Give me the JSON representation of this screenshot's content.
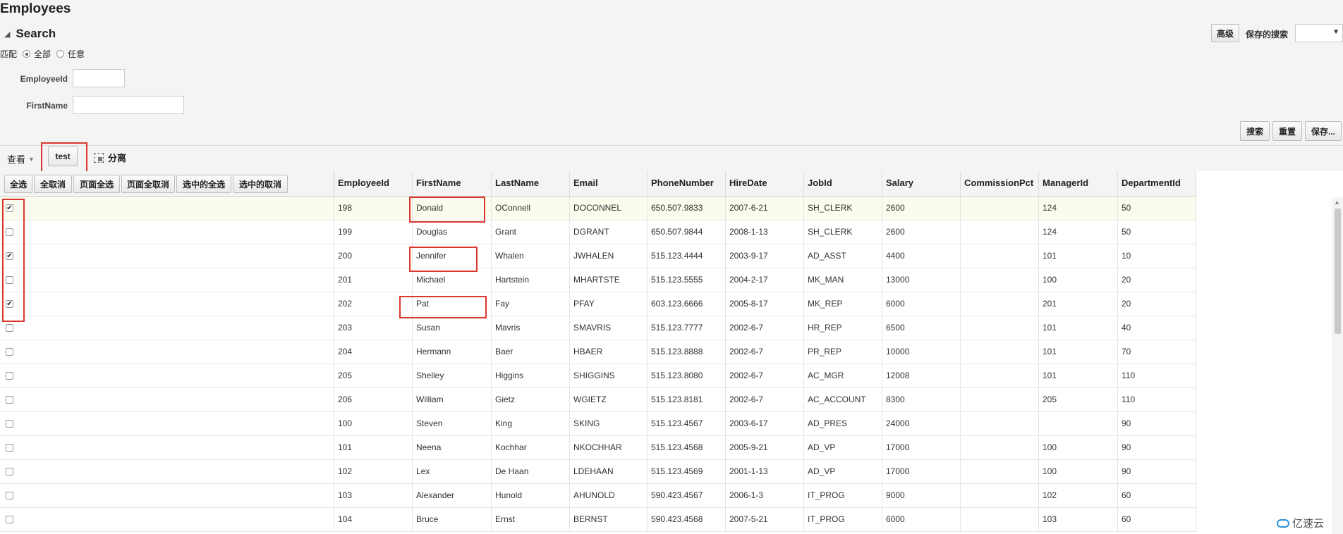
{
  "page_title": "Employees",
  "search": {
    "title": "Search",
    "match_label": "匹配",
    "match_all": "全部",
    "match_any": "任意",
    "fields": [
      {
        "label": "EmployeeId",
        "value": ""
      },
      {
        "label": "FirstName",
        "value": ""
      }
    ],
    "advanced_label": "高级",
    "saved_search_label": "保存的搜索",
    "saved_search_value": "",
    "search_button": "搜索",
    "reset_button": "重置",
    "save_button": "保存..."
  },
  "toolbar": {
    "view_label": "查看",
    "test_button": "test",
    "detach_label": "分离"
  },
  "selection_buttons": [
    "全选",
    "全取消",
    "页面全选",
    "页面全取消",
    "选中的全选",
    "选中的取消"
  ],
  "columns": [
    "EmployeeId",
    "FirstName",
    "LastName",
    "Email",
    "PhoneNumber",
    "HireDate",
    "JobId",
    "Salary",
    "CommissionPct",
    "ManagerId",
    "DepartmentId"
  ],
  "rows": [
    {
      "checked": true,
      "cells": [
        "198",
        "Donald",
        "OConnell",
        "DOCONNEL",
        "650.507.9833",
        "2007-6-21",
        "SH_CLERK",
        "2600",
        "",
        "124",
        "50"
      ]
    },
    {
      "checked": false,
      "cells": [
        "199",
        "Douglas",
        "Grant",
        "DGRANT",
        "650.507.9844",
        "2008-1-13",
        "SH_CLERK",
        "2600",
        "",
        "124",
        "50"
      ]
    },
    {
      "checked": true,
      "cells": [
        "200",
        "Jennifer",
        "Whalen",
        "JWHALEN",
        "515.123.4444",
        "2003-9-17",
        "AD_ASST",
        "4400",
        "",
        "101",
        "10"
      ]
    },
    {
      "checked": false,
      "cells": [
        "201",
        "Michael",
        "Hartstein",
        "MHARTSTE",
        "515.123.5555",
        "2004-2-17",
        "MK_MAN",
        "13000",
        "",
        "100",
        "20"
      ]
    },
    {
      "checked": true,
      "cells": [
        "202",
        "Pat",
        "Fay",
        "PFAY",
        "603.123.6666",
        "2005-8-17",
        "MK_REP",
        "6000",
        "",
        "201",
        "20"
      ]
    },
    {
      "checked": false,
      "cells": [
        "203",
        "Susan",
        "Mavris",
        "SMAVRIS",
        "515.123.7777",
        "2002-6-7",
        "HR_REP",
        "6500",
        "",
        "101",
        "40"
      ]
    },
    {
      "checked": false,
      "cells": [
        "204",
        "Hermann",
        "Baer",
        "HBAER",
        "515.123.8888",
        "2002-6-7",
        "PR_REP",
        "10000",
        "",
        "101",
        "70"
      ]
    },
    {
      "checked": false,
      "cells": [
        "205",
        "Shelley",
        "Higgins",
        "SHIGGINS",
        "515.123.8080",
        "2002-6-7",
        "AC_MGR",
        "12008",
        "",
        "101",
        "110"
      ]
    },
    {
      "checked": false,
      "cells": [
        "206",
        "William",
        "Gietz",
        "WGIETZ",
        "515.123.8181",
        "2002-6-7",
        "AC_ACCOUNT",
        "8300",
        "",
        "205",
        "110"
      ]
    },
    {
      "checked": false,
      "cells": [
        "100",
        "Steven",
        "King",
        "SKING",
        "515.123.4567",
        "2003-6-17",
        "AD_PRES",
        "24000",
        "",
        "",
        "90"
      ]
    },
    {
      "checked": false,
      "cells": [
        "101",
        "Neena",
        "Kochhar",
        "NKOCHHAR",
        "515.123.4568",
        "2005-9-21",
        "AD_VP",
        "17000",
        "",
        "100",
        "90"
      ]
    },
    {
      "checked": false,
      "cells": [
        "102",
        "Lex",
        "De Haan",
        "LDEHAAN",
        "515.123.4569",
        "2001-1-13",
        "AD_VP",
        "17000",
        "",
        "100",
        "90"
      ]
    },
    {
      "checked": false,
      "cells": [
        "103",
        "Alexander",
        "Hunold",
        "AHUNOLD",
        "590.423.4567",
        "2006-1-3",
        "IT_PROG",
        "9000",
        "",
        "102",
        "60"
      ]
    },
    {
      "checked": false,
      "cells": [
        "104",
        "Bruce",
        "Ernst",
        "BERNST",
        "590.423.4568",
        "2007-5-21",
        "IT_PROG",
        "6000",
        "",
        "103",
        "60"
      ]
    }
  ],
  "watermark": "亿速云"
}
